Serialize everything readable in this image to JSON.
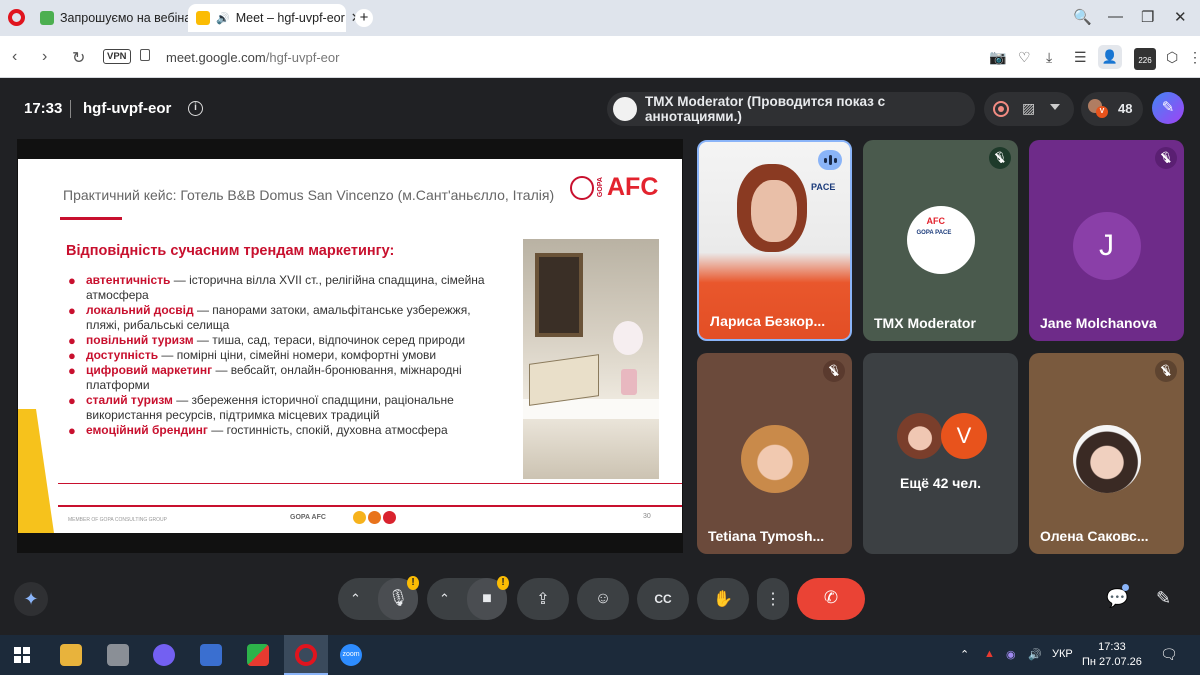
{
  "browser": {
    "tabs": [
      {
        "title": "Запрошуємо на вебінар",
        "active": false
      },
      {
        "title": "Meet – hgf-uvpf-eor",
        "active": true
      }
    ],
    "new_tab_label": "+",
    "url_host": "meet.google.com",
    "url_path": "/hgf-uvpf-eor",
    "vpn_label": "VPN",
    "extension_badge": "226",
    "window_controls": {
      "search": "🔍",
      "minimize": "—",
      "restore": "❐",
      "close": "✕"
    },
    "nav": {
      "back": "‹",
      "forward": "›",
      "reload": "↻"
    },
    "address_icons": {
      "camera": "📷",
      "heart": "♡",
      "download": "⤓",
      "menu": "☰",
      "profile": "👤",
      "cube": "⬡",
      "more": "⋮"
    }
  },
  "meet": {
    "time": "17:33",
    "meeting_code": "hgf-uvpf-eor",
    "info_icon": "i",
    "presenter_label": "TMX Moderator (Проводится показ с аннотациями.)",
    "participant_count": "48",
    "participant_badge_letter": "V"
  },
  "slide": {
    "title": "Практичний кейс: Готель B&B Domus San Vincenzo (м.Сант'аньєлло, Італія)",
    "logo_text": "AFC",
    "logo_small": "GOPA",
    "subheading": "Відповідність сучасним трендам маркетингу:",
    "bullets": [
      {
        "keyword": "автентичність",
        "text": " — історична вілла XVII ст., релігійна спадщина, сімейна атмосфера"
      },
      {
        "keyword": "локальний досвід",
        "text": " — панорами затоки, амальфітанське узбережжя, пляжі, рибальські селища"
      },
      {
        "keyword": "повільний туризм",
        "text": " — тиша, сад, тераси, відпочинок серед природи"
      },
      {
        "keyword": "доступність",
        "text": " — помірні ціни, сімейні номери, комфортні умови"
      },
      {
        "keyword": "цифровий маркетинг",
        "text": " — вебсайт, онлайн-бронювання, міжнародні платформи"
      },
      {
        "keyword": "сталий туризм",
        "text": " — збереження історичної спадщини, раціональне використання ресурсів, підтримка місцевих традицій"
      },
      {
        "keyword": "емоційний брендинг",
        "text": " — гостинність, спокій, духовна атмосфера"
      }
    ],
    "footer_small": "MEMBER OF GOPA CONSULTING GROUP",
    "footer_logo": "GOPA AFC",
    "page_number": "30"
  },
  "participants": [
    {
      "name": "Лариса Безкор...",
      "speaking": true,
      "muted": false
    },
    {
      "name": "TMX Moderator",
      "muted": true
    },
    {
      "name": "Jane Molchanova",
      "avatar_letter": "J",
      "muted": true
    },
    {
      "name": "Tetiana Tymosh...",
      "muted": true
    },
    {
      "others_label": "Ещё 42 чел.",
      "avatar_letter": "V"
    },
    {
      "name": "Олена Саковс...",
      "muted": true
    }
  ],
  "controls": {
    "chevron": "⌃",
    "mic": "🎙",
    "camera": "■",
    "present": "⇪",
    "emoji": "☺",
    "captions": "CC",
    "raise_hand": "✋",
    "more": "⋮",
    "hangup": "✆",
    "warning": "!",
    "chat": "💬",
    "activities": "✎"
  },
  "taskbar": {
    "language": "УКР",
    "time": "17:33",
    "date": "Пн 27.07.26",
    "zoom_label": "zoom"
  },
  "colors": {
    "accent_red": "#c8102e",
    "hangup": "#ea4335",
    "meet_bg": "#202124",
    "tile_purple": "#6e2b89"
  }
}
